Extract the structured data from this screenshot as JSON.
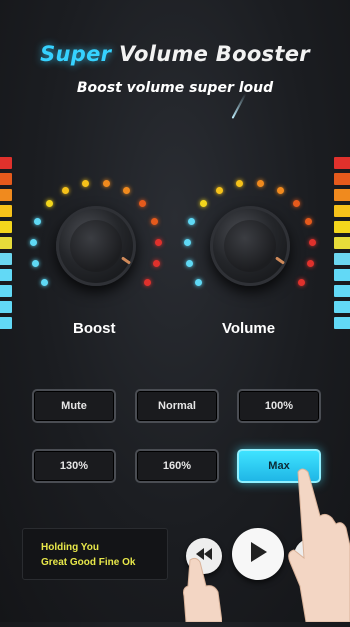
{
  "header": {
    "title_accent": "Super",
    "title_rest": "Volume Booster",
    "subtitle": "Boost volume super loud"
  },
  "knobs": {
    "boost_label": "Boost",
    "volume_label": "Volume"
  },
  "buttons": {
    "mute": "Mute",
    "normal": "Normal",
    "p100": "100%",
    "p130": "130%",
    "p160": "160%",
    "max": "Max",
    "active": "Max"
  },
  "player": {
    "line1": "Holding You",
    "line2": "Great Good Fine Ok"
  },
  "icons": [
    "previous-icon",
    "play-icon",
    "next-icon",
    "hand-pointer-icon"
  ],
  "colors": {
    "accent": "#36d2ff",
    "song_text": "#e8e84a",
    "meter": [
      "#e0312c",
      "#e55a1c",
      "#f08a1e",
      "#f6c21a",
      "#f3d61c",
      "#e6dc3a",
      "#6cd6ef",
      "#62d9f6"
    ]
  }
}
